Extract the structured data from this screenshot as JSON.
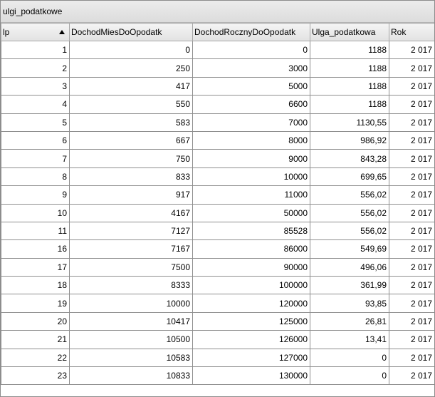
{
  "window": {
    "title": "ulgi_podatkowe"
  },
  "table": {
    "headers": {
      "lp": "lp",
      "mies": "DochodMiesDoOpodatk",
      "rocz": "DochodRocznyDoOpodatk",
      "ulga": "Ulga_podatkowa",
      "rok": "Rok"
    },
    "sort": {
      "column": "lp",
      "direction": "ascending",
      "icon": "sort-ascending-icon"
    },
    "rows": [
      {
        "lp": "1",
        "mies": "0",
        "rocz": "0",
        "ulga": "1188",
        "rok": "2 017"
      },
      {
        "lp": "2",
        "mies": "250",
        "rocz": "3000",
        "ulga": "1188",
        "rok": "2 017"
      },
      {
        "lp": "3",
        "mies": "417",
        "rocz": "5000",
        "ulga": "1188",
        "rok": "2 017"
      },
      {
        "lp": "4",
        "mies": "550",
        "rocz": "6600",
        "ulga": "1188",
        "rok": "2 017"
      },
      {
        "lp": "5",
        "mies": "583",
        "rocz": "7000",
        "ulga": "1130,55",
        "rok": "2 017"
      },
      {
        "lp": "6",
        "mies": "667",
        "rocz": "8000",
        "ulga": "986,92",
        "rok": "2 017"
      },
      {
        "lp": "7",
        "mies": "750",
        "rocz": "9000",
        "ulga": "843,28",
        "rok": "2 017"
      },
      {
        "lp": "8",
        "mies": "833",
        "rocz": "10000",
        "ulga": "699,65",
        "rok": "2 017"
      },
      {
        "lp": "9",
        "mies": "917",
        "rocz": "11000",
        "ulga": "556,02",
        "rok": "2 017"
      },
      {
        "lp": "10",
        "mies": "4167",
        "rocz": "50000",
        "ulga": "556,02",
        "rok": "2 017"
      },
      {
        "lp": "11",
        "mies": "7127",
        "rocz": "85528",
        "ulga": "556,02",
        "rok": "2 017"
      },
      {
        "lp": "16",
        "mies": "7167",
        "rocz": "86000",
        "ulga": "549,69",
        "rok": "2 017"
      },
      {
        "lp": "17",
        "mies": "7500",
        "rocz": "90000",
        "ulga": "496,06",
        "rok": "2 017"
      },
      {
        "lp": "18",
        "mies": "8333",
        "rocz": "100000",
        "ulga": "361,99",
        "rok": "2 017"
      },
      {
        "lp": "19",
        "mies": "10000",
        "rocz": "120000",
        "ulga": "93,85",
        "rok": "2 017"
      },
      {
        "lp": "20",
        "mies": "10417",
        "rocz": "125000",
        "ulga": "26,81",
        "rok": "2 017"
      },
      {
        "lp": "21",
        "mies": "10500",
        "rocz": "126000",
        "ulga": "13,41",
        "rok": "2 017"
      },
      {
        "lp": "22",
        "mies": "10583",
        "rocz": "127000",
        "ulga": "0",
        "rok": "2 017"
      },
      {
        "lp": "23",
        "mies": "10833",
        "rocz": "130000",
        "ulga": "0",
        "rok": "2 017"
      }
    ]
  }
}
